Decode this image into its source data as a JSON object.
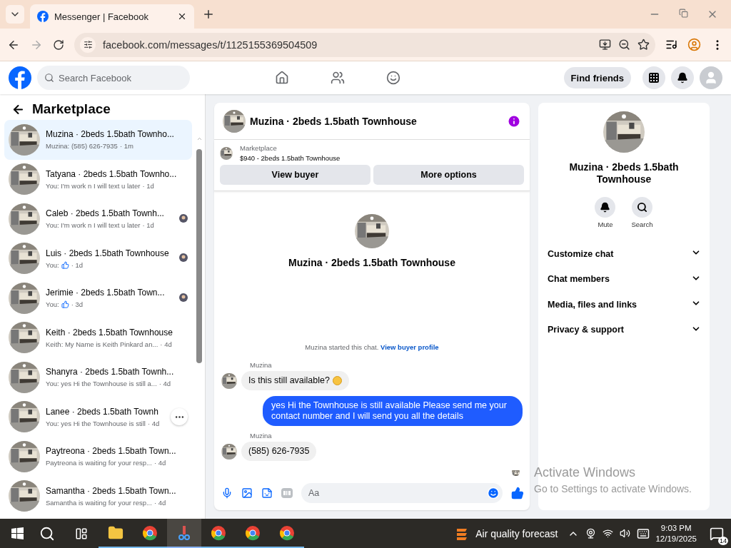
{
  "browser": {
    "tab_title": "Messenger | Facebook",
    "url": "facebook.com/messages/t/1125155369504509"
  },
  "nav": {
    "search_placeholder": "Search Facebook",
    "find_friends": "Find friends"
  },
  "sidebar": {
    "title": "Marketplace",
    "items": [
      {
        "title": "Muzina · 2beds 1.5bath Townho...",
        "preview": "Muzina: (585) 626-7935",
        "time": "· 1m",
        "like": false,
        "read_receipt": false,
        "selected": true
      },
      {
        "title": "Tatyana · 2beds 1.5bath Townho...",
        "preview": "You: I'm work n I will text u later",
        "time": "· 1d",
        "like": false,
        "read_receipt": false,
        "selected": false
      },
      {
        "title": "Caleb · 2beds 1.5bath Townh...",
        "preview": "You: I'm work n I will text u later",
        "time": "· 1d",
        "like": false,
        "read_receipt": true,
        "selected": false
      },
      {
        "title": "Luis · 2beds 1.5bath Townhouse",
        "preview": "You:",
        "time": "· 1d",
        "like": true,
        "read_receipt": true,
        "selected": false
      },
      {
        "title": "Jerimie · 2beds 1.5bath Town...",
        "preview": "You:",
        "time": "· 3d",
        "like": true,
        "read_receipt": true,
        "selected": false
      },
      {
        "title": "Keith · 2beds 1.5bath Townhouse",
        "preview": "Keith: My Name is Keith Pinkard an...",
        "time": "· 4d",
        "like": false,
        "read_receipt": false,
        "selected": false
      },
      {
        "title": "Shanyra · 2beds 1.5bath Townh...",
        "preview": "You: yes Hi the Townhouse is still a...",
        "time": "· 4d",
        "like": false,
        "read_receipt": false,
        "selected": false
      },
      {
        "title": "Lanee · 2beds 1.5bath Townh",
        "preview": "You: yes Hi the Townhouse is still",
        "time": "· 4d",
        "like": false,
        "read_receipt": false,
        "selected": false,
        "hovered": true
      },
      {
        "title": "Paytreona · 2beds 1.5bath Town...",
        "preview": "Paytreona is waiting for your resp...",
        "time": "· 4d",
        "like": false,
        "read_receipt": false,
        "selected": false
      },
      {
        "title": "Samantha · 2beds 1.5bath Town...",
        "preview": "Samantha is waiting for your resp...",
        "time": "· 4d",
        "like": false,
        "read_receipt": false,
        "selected": false
      }
    ]
  },
  "chat": {
    "title": "Muzina · 2beds 1.5bath Townhouse",
    "listing_source": "Marketplace",
    "listing": "$940 - 2beds 1.5bath Townhouse",
    "buttons": [
      "View buyer",
      "More options"
    ],
    "intro_name": "Muzina · 2beds 1.5bath Townhouse",
    "started_text": "Muzina started this chat.",
    "started_link": "View buyer profile",
    "messages": [
      {
        "sender": "Muzina",
        "text": "Is this still available?",
        "emoji": true,
        "outgoing": false
      },
      {
        "text": "yes Hi the Townhouse is still available Please send me your contact number and I will send you all the details",
        "emoji": false,
        "outgoing": true
      },
      {
        "sender": "Muzina",
        "text": "(585) 626-7935",
        "emoji": false,
        "outgoing": false
      }
    ],
    "composer_placeholder": "Aa"
  },
  "details": {
    "name": "Muzina · 2beds 1.5bath Townhouse",
    "actions": [
      {
        "kind": "mute",
        "label": "Mute"
      },
      {
        "kind": "search",
        "label": "Search"
      }
    ],
    "sections": [
      {
        "label": "Customize chat",
        "expanded": false
      },
      {
        "label": "Chat members",
        "expanded": false
      },
      {
        "label": "Media, files and links",
        "expanded": false
      },
      {
        "label": "Privacy & support",
        "expanded": false
      }
    ]
  },
  "os_notice": {
    "title": "Activate Windows",
    "text": "Go to Settings to activate Windows."
  },
  "taskbar": {
    "apps": [
      {
        "kind": "folder",
        "active": false
      },
      {
        "kind": "chrome",
        "active": false
      },
      {
        "kind": "tool",
        "active": true
      },
      {
        "kind": "chrome",
        "active": false
      },
      {
        "kind": "chrome",
        "active": false
      },
      {
        "kind": "chrome",
        "active": false
      }
    ],
    "weather": "Air quality forecast",
    "time": "9:03 PM",
    "date": "12/19/2025",
    "notifications": "14"
  }
}
